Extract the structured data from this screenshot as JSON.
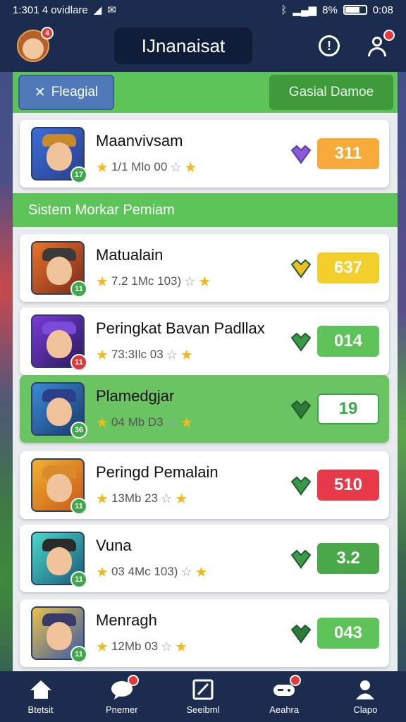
{
  "status_bar": {
    "left": "1:301 4 ovidlare",
    "battery": "8%",
    "time": "0:08"
  },
  "header": {
    "title": "IJnanaisat",
    "avatar_badge": "4"
  },
  "tabs": {
    "left_label": "Fleagial",
    "right_label": "Gasial Damoe"
  },
  "section_title": "Sistem Morkar Pemiam",
  "featured": {
    "name": "Maanvivsam",
    "meta": "1/1 Mlo 00",
    "level": "17",
    "score": "311",
    "score_color": "#f7a93a",
    "gem_color": "#8a5ad8",
    "hat_color": "#c78a2a"
  },
  "rows": [
    {
      "name": "Matualain",
      "meta": "7.2 1Mc 103)",
      "level": "11",
      "score": "637",
      "score_color": "#f2cf2a",
      "level_color": "#3ca84a",
      "gem_color": "#e8c020",
      "hat_color": "#3a3a3a"
    },
    {
      "name": "Peringkat Bavan Padllax",
      "meta": "73:3Ilc 03",
      "level": "11",
      "score": "014",
      "score_color": "#5ec45a",
      "level_color": "#d83a3a",
      "gem_color": "#3a9a4a",
      "hat_color": "#7a4ad8"
    },
    {
      "name": "Plamedgjar",
      "meta": "04 Mb D3",
      "level": "36",
      "score": "19",
      "score_color": "#ffffff",
      "level_color": "#3ca84a",
      "gem_color": "#2f7a3a",
      "hat_color": "#2a3e8a"
    },
    {
      "name": "Peringd Pemalain",
      "meta": "13Mb 23",
      "level": "11",
      "score": "510",
      "score_color": "#e6394a",
      "level_color": "#3ca84a",
      "gem_color": "#3a9a4a",
      "hat_color": "#d98a2a"
    },
    {
      "name": "Vuna",
      "meta": "03 4Mc 103)",
      "level": "11",
      "score": "3.2",
      "score_color": "#4aa84a",
      "level_color": "#3ca84a",
      "gem_color": "#3a9a4a",
      "hat_color": "#2a2a2a"
    },
    {
      "name": "Menragh",
      "meta": "12Mb 03",
      "level": "11",
      "score": "043",
      "score_color": "#5ec45a",
      "level_color": "#3ca84a",
      "gem_color": "#2f7a3a",
      "hat_color": "#3a3a6a"
    }
  ],
  "nav": [
    {
      "label": "Btetsit",
      "icon": "home-icon"
    },
    {
      "label": "Pnemer",
      "icon": "chat-icon",
      "badge": true
    },
    {
      "label": "Seeibml",
      "icon": "edit-icon"
    },
    {
      "label": "Aeahra",
      "icon": "gamepad-icon",
      "badge": true
    },
    {
      "label": "Clapo",
      "icon": "profile-icon"
    }
  ]
}
